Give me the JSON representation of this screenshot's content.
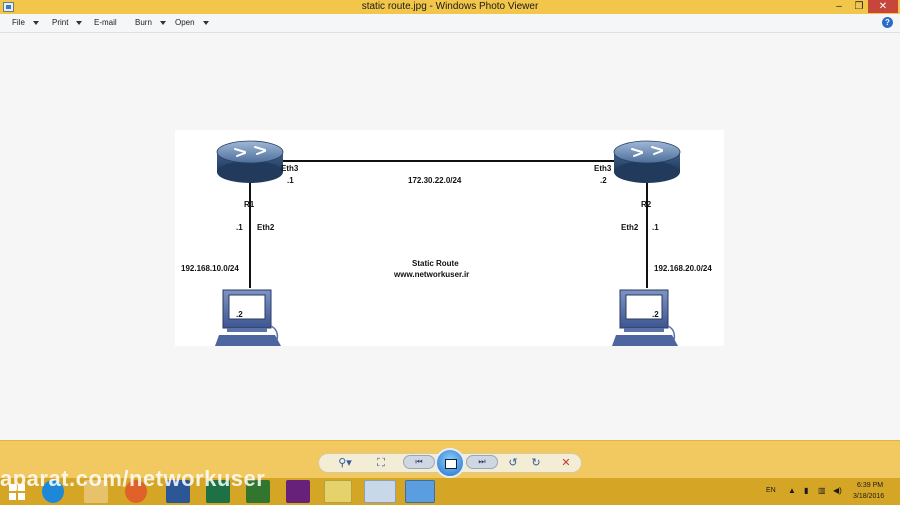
{
  "window": {
    "title": "static route.jpg - Windows Photo Viewer",
    "minimize_label": "–",
    "maximize_label": "❐",
    "close_label": "✕"
  },
  "menu": {
    "file": "File",
    "print": "Print",
    "email": "E-mail",
    "burn": "Burn",
    "open": "Open",
    "help_glyph": "?"
  },
  "diagram": {
    "r1_name": "R1",
    "r2_name": "R2",
    "r1_eth3": "Eth3",
    "r1_eth3_addr": ".1",
    "r2_eth3": "Eth3",
    "r2_eth3_addr": ".2",
    "link_network": "172.30.22.0/24",
    "r1_eth2": "Eth2",
    "r1_eth2_addr": ".1",
    "r2_eth2": "Eth2",
    "r2_eth2_addr": ".1",
    "lan1_network": "192.168.10.0/24",
    "lan2_network": "192.168.20.0/24",
    "pc1_addr": ".2",
    "pc2_addr": ".2",
    "center_title": "Static Route",
    "center_url": "www.networkuser.ir"
  },
  "controls": {
    "zoom_glyph": "⚲▾",
    "fit_glyph": "⛶",
    "prev_glyph": "⏮",
    "next_glyph": "⏭",
    "rotate_ccw_glyph": "↺",
    "rotate_cw_glyph": "↻",
    "delete_glyph": "✕"
  },
  "taskbar": {
    "language": "EN",
    "time": "6:39 PM",
    "date": "3/18/2016",
    "watermark": "aparat.com/networkuser"
  },
  "colors": {
    "accent": "#2a6cc8",
    "close_red": "#c7463b",
    "taskbar": "#d5a526"
  }
}
